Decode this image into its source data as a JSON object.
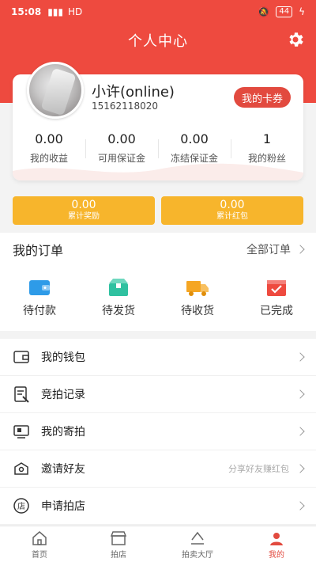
{
  "status_bar": {
    "time": "15:08",
    "signal": "HD",
    "battery": "44"
  },
  "header": {
    "title": "个人中心"
  },
  "profile": {
    "name": "小许(online)",
    "phone": "15162118020",
    "coupon_button": "我的卡券",
    "stats": [
      {
        "value": "0.00",
        "label": "我的收益"
      },
      {
        "value": "0.00",
        "label": "可用保证金"
      },
      {
        "value": "0.00",
        "label": "冻结保证金"
      },
      {
        "value": "1",
        "label": "我的粉丝"
      }
    ]
  },
  "rewards": [
    {
      "value": "0.00",
      "label": "累计奖励"
    },
    {
      "value": "0.00",
      "label": "累计红包"
    }
  ],
  "orders": {
    "title": "我的订单",
    "all_link": "全部订单",
    "tabs": [
      {
        "label": "待付款",
        "icon": "wallet-icon",
        "color": "#2e9be8"
      },
      {
        "label": "待发货",
        "icon": "package-icon",
        "color": "#2fc1a0"
      },
      {
        "label": "待收货",
        "icon": "truck-icon",
        "color": "#f5a623"
      },
      {
        "label": "已完成",
        "icon": "calendar-check-icon",
        "color": "#ee4a3f"
      }
    ]
  },
  "menu": [
    {
      "label": "我的钱包",
      "icon": "wallet-outline-icon",
      "hint": ""
    },
    {
      "label": "竞拍记录",
      "icon": "auction-record-icon",
      "hint": ""
    },
    {
      "label": "我的寄拍",
      "icon": "consign-icon",
      "hint": ""
    },
    {
      "label": "邀请好友",
      "icon": "invite-icon",
      "hint": "分享好友赚红包"
    },
    {
      "label": "申请拍店",
      "icon": "shop-icon",
      "hint": ""
    }
  ],
  "tabbar": [
    {
      "label": "首页",
      "icon": "home-icon"
    },
    {
      "label": "拍店",
      "icon": "store-icon"
    },
    {
      "label": "拍卖大厅",
      "icon": "auction-hall-icon"
    },
    {
      "label": "我的",
      "icon": "user-icon"
    }
  ],
  "colors": {
    "primary": "#ee4a3f",
    "accent": "#f7b52c"
  }
}
